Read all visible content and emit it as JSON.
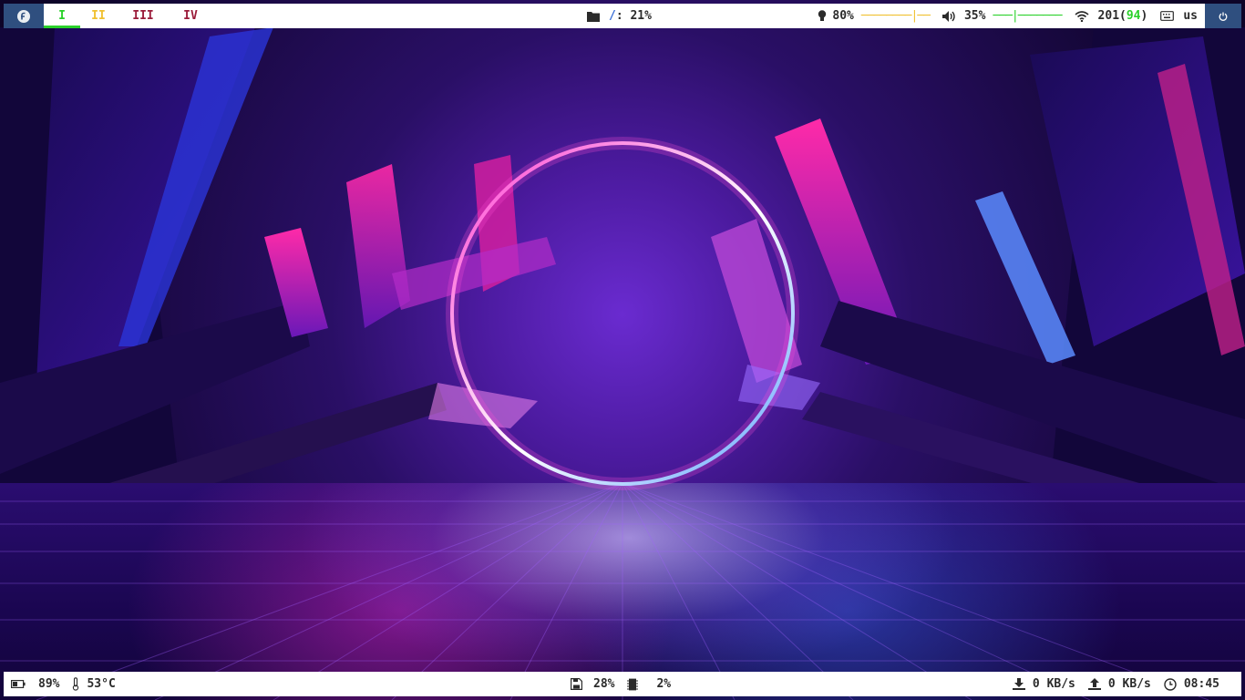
{
  "colors": {
    "bar_bg": "#ffffff",
    "accent_box": "#2f4f7f",
    "ws1": "#2ad12a",
    "ws2": "#f0c030",
    "ws3": "#9b1c3a",
    "ws4": "#9b1c3a",
    "path_slash": "#3a6fd8",
    "wifi_quality": "#2ad12a"
  },
  "topbar": {
    "logo_icon": "fedora-logo-icon",
    "workspaces": [
      {
        "label": "I",
        "active": true
      },
      {
        "label": "II",
        "active": false
      },
      {
        "label": "III",
        "active": false
      },
      {
        "label": "IV",
        "active": false
      }
    ],
    "disk": {
      "icon": "folder-icon",
      "path": "/",
      "value": ": 21%"
    },
    "brightness": {
      "icon": "lightbulb-icon",
      "value": "80%",
      "slider": "────────|──"
    },
    "volume": {
      "icon": "speaker-icon",
      "value": "35%",
      "slider": "───|───────"
    },
    "wifi": {
      "icon": "wifi-icon",
      "value": "201",
      "quality": "94"
    },
    "keyboard": {
      "icon": "keyboard-icon",
      "layout": "us"
    },
    "power_icon": "power-icon"
  },
  "bottombar": {
    "battery": {
      "icon": "battery-icon",
      "value": "89%"
    },
    "temperature": {
      "icon": "thermometer-icon",
      "value": "53°C"
    },
    "memory": {
      "icon": "floppy-disk-icon",
      "value": "28%"
    },
    "cpu": {
      "icon": "cpu-chip-icon",
      "value": "2%"
    },
    "download": {
      "icon": "download-icon",
      "value": "0 KB/s"
    },
    "upload": {
      "icon": "upload-icon",
      "value": "0 KB/s"
    },
    "clock": {
      "icon": "clock-icon",
      "value": "08:45"
    }
  }
}
